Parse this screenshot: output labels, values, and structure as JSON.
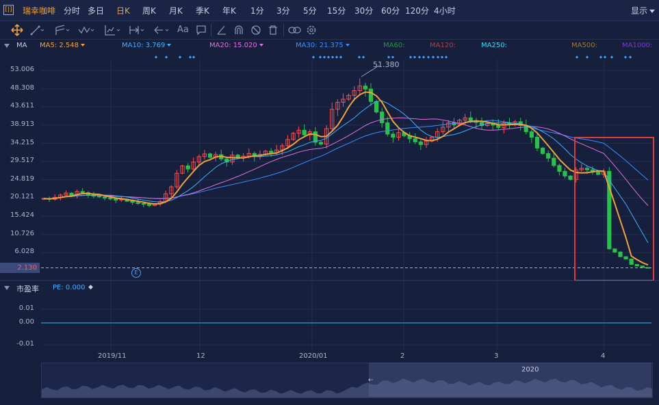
{
  "header": {
    "logo_glyph": "[|]",
    "stock_name": "瑞幸咖啡",
    "periods": [
      "分时",
      "多日",
      "日K",
      "周K",
      "月K",
      "季K",
      "年K",
      "1分",
      "3分",
      "5分",
      "15分",
      "30分",
      "60分",
      "120分",
      "4小时"
    ],
    "active_period": "日K",
    "display_label": "显示"
  },
  "toolbar": {
    "text_tool_label": "Aa"
  },
  "ma_legend": {
    "title": "MA",
    "items": [
      {
        "label": "MA5: 2.548",
        "color": "#f0a33a"
      },
      {
        "label": "MA10: 3.769",
        "color": "#3fb0ff"
      },
      {
        "label": "MA20: 15.020",
        "color": "#e070e0"
      },
      {
        "label": "MA30: 21.375",
        "color": "#3a8dff"
      },
      {
        "label": "MA60:",
        "color": "#2f8f4f"
      },
      {
        "label": "MA120:",
        "color": "#b04040"
      },
      {
        "label": "MA250:",
        "color": "#3fd8f0"
      },
      {
        "label": "MA500:",
        "color": "#9a7a40"
      },
      {
        "label": "MA1000:",
        "color": "#7040c0"
      }
    ]
  },
  "chart_data": {
    "type": "candlestick",
    "title": "瑞幸咖啡 日K",
    "y_axis_ticks": [
      "53.006",
      "48.308",
      "43.611",
      "38.913",
      "34.215",
      "29.517",
      "24.819",
      "20.121",
      "15.424",
      "10.726",
      "6.028"
    ],
    "ylim": [
      1.33,
      56.0
    ],
    "x_axis_labels": [
      "2019/11",
      "12",
      "2020/01",
      "2",
      "3",
      "4"
    ],
    "current_price": "2.130",
    "max_label": "51.380",
    "marker_label": "E",
    "ma_colors": {
      "ma5": "#f0a33a",
      "ma10": "#3fb0ff",
      "ma20": "#e070e0",
      "ma30": "#3a8dff"
    },
    "close_series": [
      20.0,
      19.8,
      20.3,
      20.9,
      21.4,
      20.7,
      21.8,
      21.5,
      21.0,
      20.6,
      20.4,
      20.1,
      19.9,
      19.6,
      19.8,
      19.3,
      19.0,
      18.7,
      18.5,
      18.2,
      18.6,
      19.2,
      21.2,
      23.0,
      26.5,
      28.4,
      27.6,
      29.4,
      30.8,
      31.5,
      30.6,
      31.3,
      30.2,
      29.4,
      31.2,
      30.5,
      30.9,
      31.6,
      30.8,
      31.4,
      32.2,
      31.8,
      32.5,
      33.6,
      35.2,
      36.8,
      37.6,
      36.4,
      37.2,
      34.5,
      34.0,
      38.0,
      43.0,
      44.8,
      45.6,
      46.6,
      47.8,
      49.0,
      48.2,
      45.0,
      42.3,
      39.5,
      36.6,
      35.8,
      37.0,
      36.2,
      35.4,
      34.6,
      33.9,
      34.8,
      35.8,
      37.2,
      38.4,
      39.5,
      39.0,
      40.2,
      40.8,
      40.1,
      39.6,
      38.8,
      39.4,
      38.9,
      38.3,
      39.5,
      39.0,
      39.8,
      38.8,
      37.2,
      35.8,
      33.0,
      31.6,
      30.4,
      28.5,
      27.0,
      25.8,
      24.9,
      27.4,
      27.8,
      27.4,
      26.8,
      26.2,
      27.0,
      7.0,
      6.2,
      5.0,
      4.4,
      3.0,
      2.6,
      2.2,
      2.13
    ],
    "pe_label": "市盈率",
    "pe_value_label": "PE: 0.000",
    "pe_ticks": [
      "0.01",
      "0.00",
      "-0.01"
    ],
    "navigator_year": "2020"
  }
}
